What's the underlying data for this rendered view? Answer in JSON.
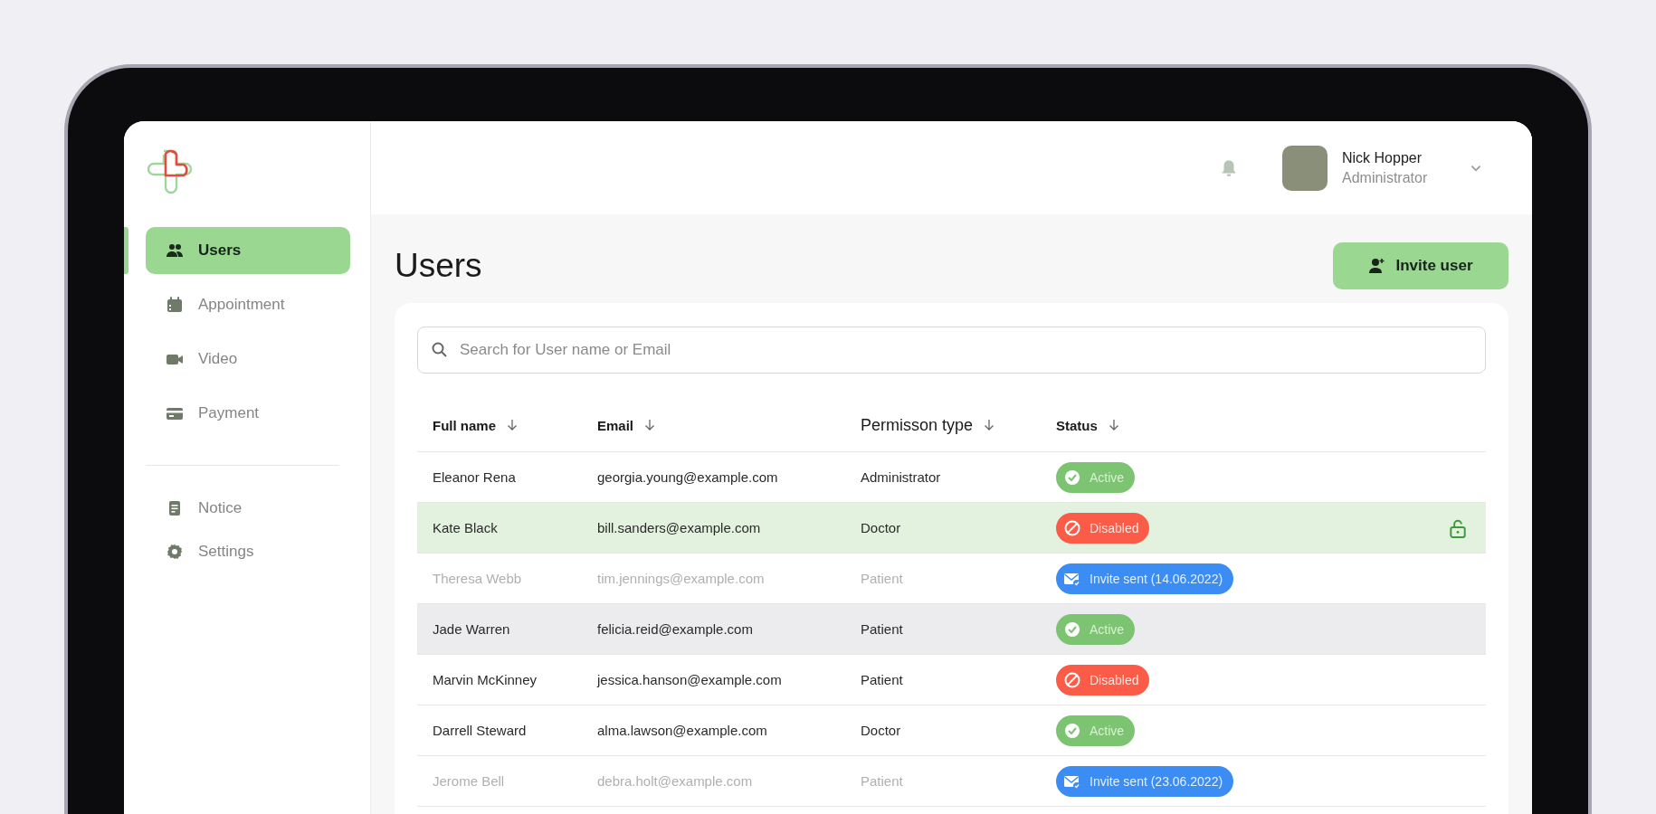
{
  "sidebar": {
    "items": [
      {
        "label": "Users",
        "kind": "users",
        "selected": true
      },
      {
        "label": "Appointment",
        "kind": "calendar",
        "selected": false
      },
      {
        "label": "Video",
        "kind": "video",
        "selected": false
      },
      {
        "label": "Payment",
        "kind": "card",
        "selected": false
      }
    ],
    "bottom_items": [
      {
        "label": "Notice",
        "kind": "note",
        "selected": false
      },
      {
        "label": "Settings",
        "kind": "gear",
        "selected": false
      }
    ]
  },
  "header": {
    "user": {
      "name": "Nick Hopper",
      "role": "Administrator"
    }
  },
  "page": {
    "title": "Users",
    "invite_button": "Invite user"
  },
  "search": {
    "placeholder": "Search for User name or Email"
  },
  "table": {
    "columns": [
      "Full name",
      "Email",
      "Permisson type",
      "Status"
    ],
    "rows": [
      {
        "name": "Eleanor Rena",
        "email": "georgia.young@example.com",
        "permission": "Administrator",
        "status": "Active",
        "kind": "active",
        "selected": false,
        "hovered": false,
        "dimmed": false
      },
      {
        "name": "Kate Black",
        "email": "bill.sanders@example.com",
        "permission": "Doctor",
        "status": "Disabled",
        "kind": "disabled",
        "selected": true,
        "hovered": false,
        "dimmed": false
      },
      {
        "name": "Theresa Webb",
        "email": "tim.jennings@example.com",
        "permission": "Patient",
        "status": "Invite sent (14.06.2022)",
        "kind": "invited",
        "selected": false,
        "hovered": false,
        "dimmed": true
      },
      {
        "name": "Jade Warren",
        "email": "felicia.reid@example.com",
        "permission": "Patient",
        "status": "Active",
        "kind": "active",
        "selected": false,
        "hovered": true,
        "dimmed": false
      },
      {
        "name": "Marvin McKinney",
        "email": "jessica.hanson@example.com",
        "permission": "Patient",
        "status": "Disabled",
        "kind": "disabled",
        "selected": false,
        "hovered": false,
        "dimmed": false
      },
      {
        "name": "Darrell Steward",
        "email": "alma.lawson@example.com",
        "permission": "Doctor",
        "status": "Active",
        "kind": "active",
        "selected": false,
        "hovered": false,
        "dimmed": false
      },
      {
        "name": "Jerome Bell",
        "email": "debra.holt@example.com",
        "permission": "Patient",
        "status": "Invite sent (23.06.2022)",
        "kind": "invited",
        "selected": false,
        "hovered": false,
        "dimmed": true
      }
    ]
  }
}
